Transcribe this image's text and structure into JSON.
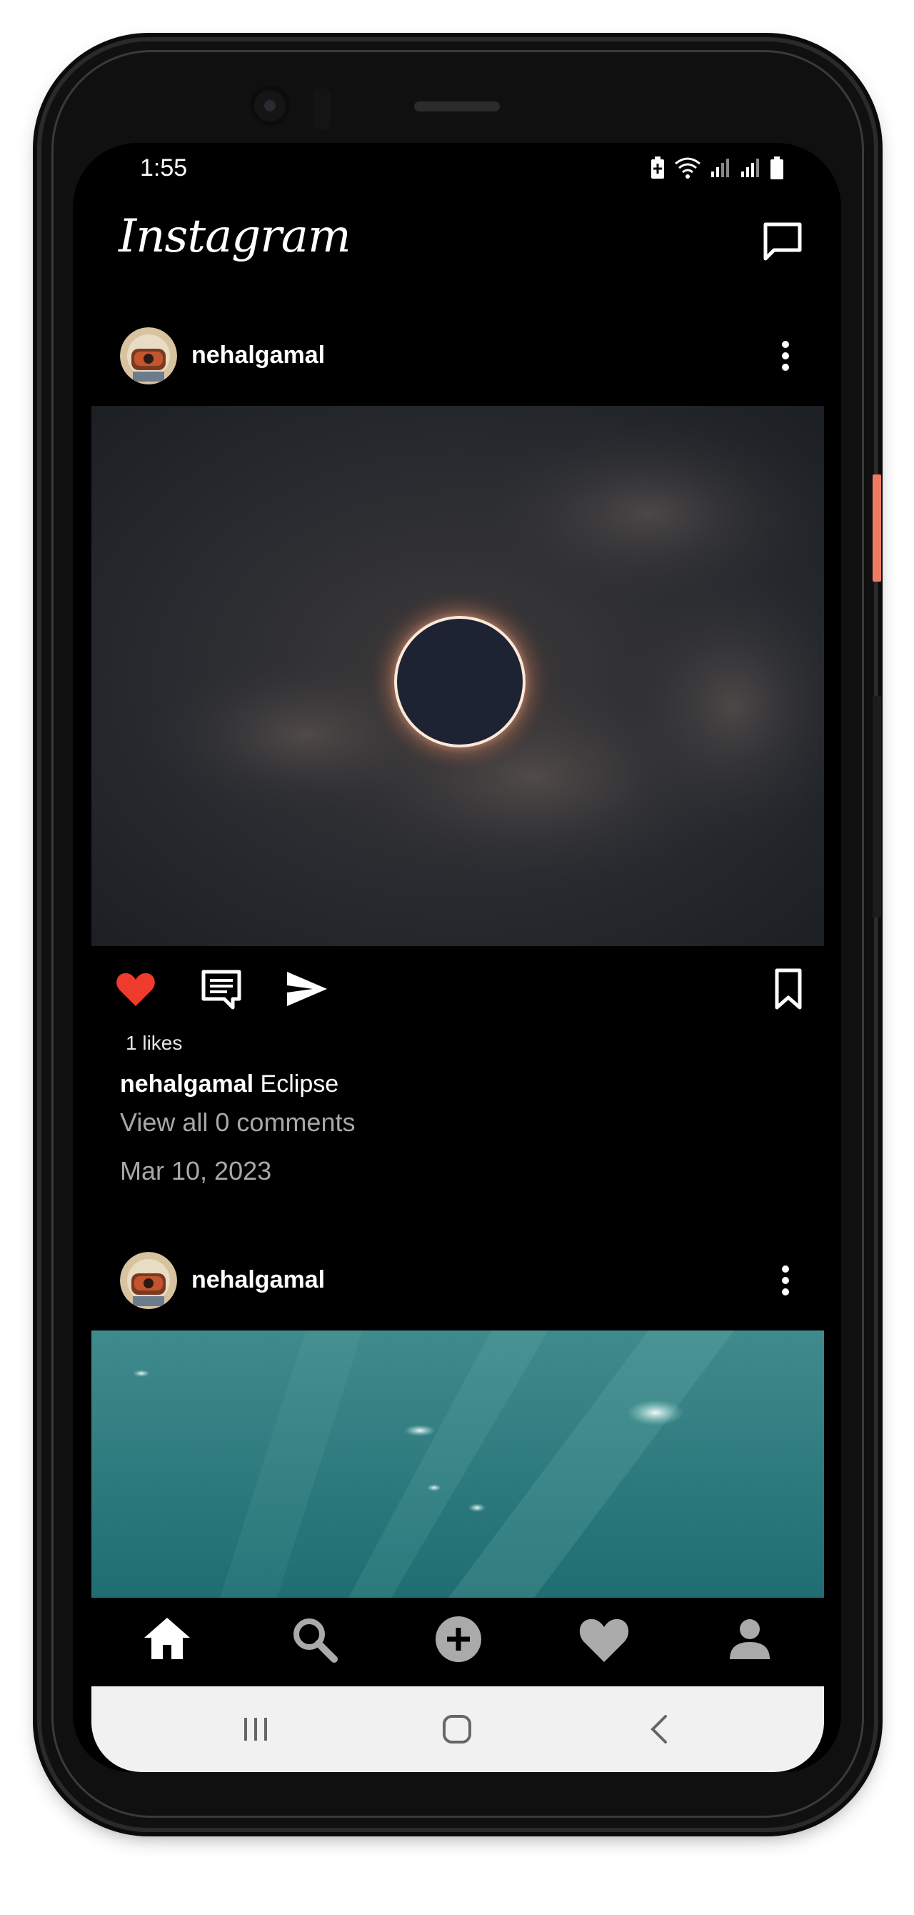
{
  "status_bar": {
    "time": "1:55",
    "icons": [
      "battery-saver-icon",
      "wifi-icon",
      "signal-icon",
      "signal-icon",
      "battery-icon"
    ]
  },
  "header": {
    "logo": "Instagram",
    "dm_icon": "message-icon"
  },
  "posts": [
    {
      "username": "nehalgamal",
      "image": "solar-eclipse-photo",
      "likes": "1 likes",
      "caption_user": "nehalgamal",
      "caption_text": "Eclipse",
      "comments_link": "View all 0 comments",
      "date": "Mar 10, 2023",
      "liked": true
    },
    {
      "username": "nehalgamal",
      "image": "underwater-light-photo"
    }
  ],
  "bottom_nav": {
    "items": [
      "home-icon",
      "search-icon",
      "add-post-icon",
      "activity-heart-icon",
      "profile-icon"
    ],
    "active": "home-icon"
  },
  "system_nav": [
    "recents-icon",
    "home-circle-icon",
    "back-icon"
  ],
  "colors": {
    "background": "#000000",
    "like_red": "#ef3b2d",
    "text_secondary": "#a8a8a8",
    "system_nav_bg": "#f1f1f1"
  }
}
